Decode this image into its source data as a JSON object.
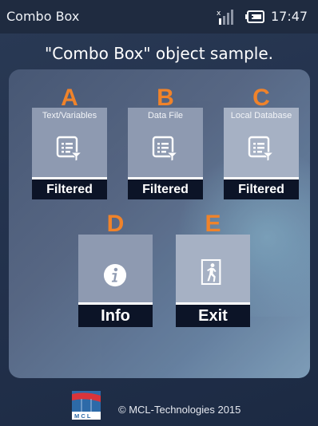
{
  "status_bar": {
    "title": "Combo Box",
    "time": "17:47",
    "icons": [
      "signal-no-service-icon",
      "battery-charging-icon"
    ]
  },
  "page": {
    "title": "\"Combo Box\" object sample."
  },
  "tiles": [
    {
      "letter": "A",
      "caption": "Text/Variables",
      "label": "Filtered",
      "icon": "filter-list-icon"
    },
    {
      "letter": "B",
      "caption": "Data File",
      "label": "Filtered",
      "icon": "filter-list-icon"
    },
    {
      "letter": "C",
      "caption": "Local Database",
      "label": "Filtered",
      "icon": "filter-list-icon"
    },
    {
      "letter": "D",
      "caption": "",
      "label": "Info",
      "icon": "info-icon"
    },
    {
      "letter": "E",
      "caption": "",
      "label": "Exit",
      "icon": "exit-door-icon"
    }
  ],
  "footer": {
    "logo_text": "M C L",
    "copyright": "© MCL-Technologies  2015"
  },
  "colors": {
    "letter_accent": "#f0832a",
    "label_bar": "#0c1427",
    "tile_face": "#8e9ab1"
  }
}
